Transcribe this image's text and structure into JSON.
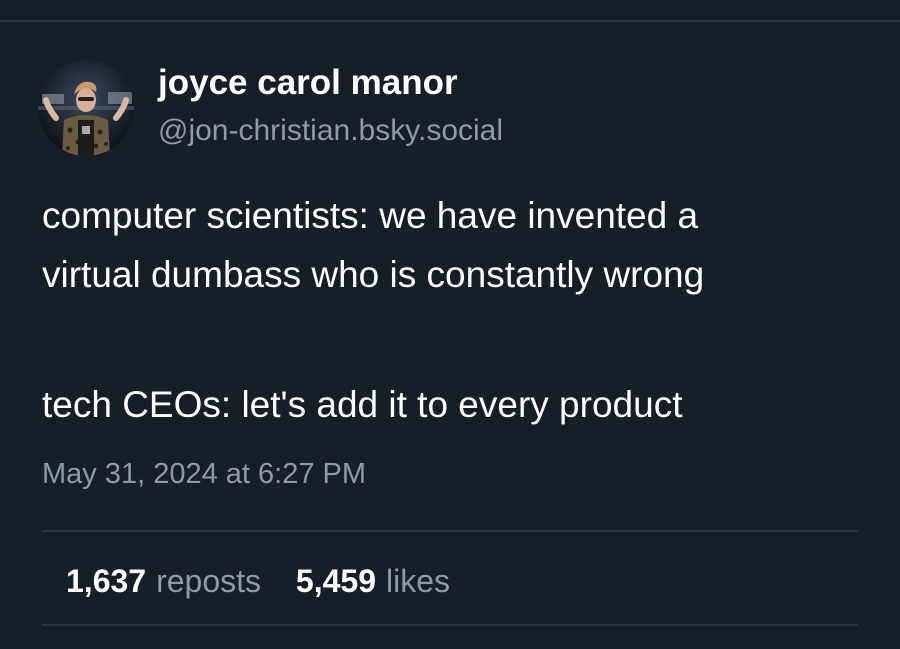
{
  "author": {
    "display_name": "joyce carol manor",
    "handle": "@jon-christian.bsky.social",
    "avatar": "profile-photo"
  },
  "post": {
    "lines": [
      "computer scientists: we have invented a",
      "virtual dumbass who is constantly wrong",
      "tech CEOs: let's add it to every product"
    ],
    "timestamp": "May 31, 2024 at 6:27 PM"
  },
  "stats": {
    "reposts_count": "1,637",
    "reposts_label": "reposts",
    "likes_count": "5,459",
    "likes_label": "likes"
  },
  "colors": {
    "background": "#161e27",
    "text": "#ffffff",
    "muted": "#8d9aa8",
    "divider": "#2b3540"
  }
}
